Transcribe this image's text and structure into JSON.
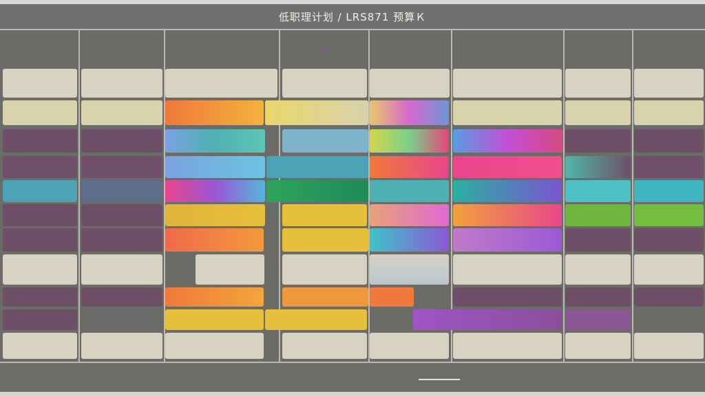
{
  "window": {
    "title": "低职理计划 / LRS871 预算Ｋ"
  },
  "header": {
    "columns": [
      "",
      "",
      "",
      "",
      "",
      "",
      "",
      ""
    ]
  },
  "rows": [
    {
      "cells": [
        "",
        "",
        "",
        "",
        "",
        "",
        "",
        "",
        ""
      ]
    }
  ],
  "footer": {
    "left": "",
    "mid": "",
    "right": ""
  },
  "colors": {
    "beige": "#d9d4c3",
    "purple": "#6e4f68",
    "teal": "#4da3b5",
    "orange": "#f0793b",
    "yellow": "#e6c03a",
    "magenta": "#e9468b",
    "green": "#2fa35c",
    "blue": "#6f93d6"
  }
}
